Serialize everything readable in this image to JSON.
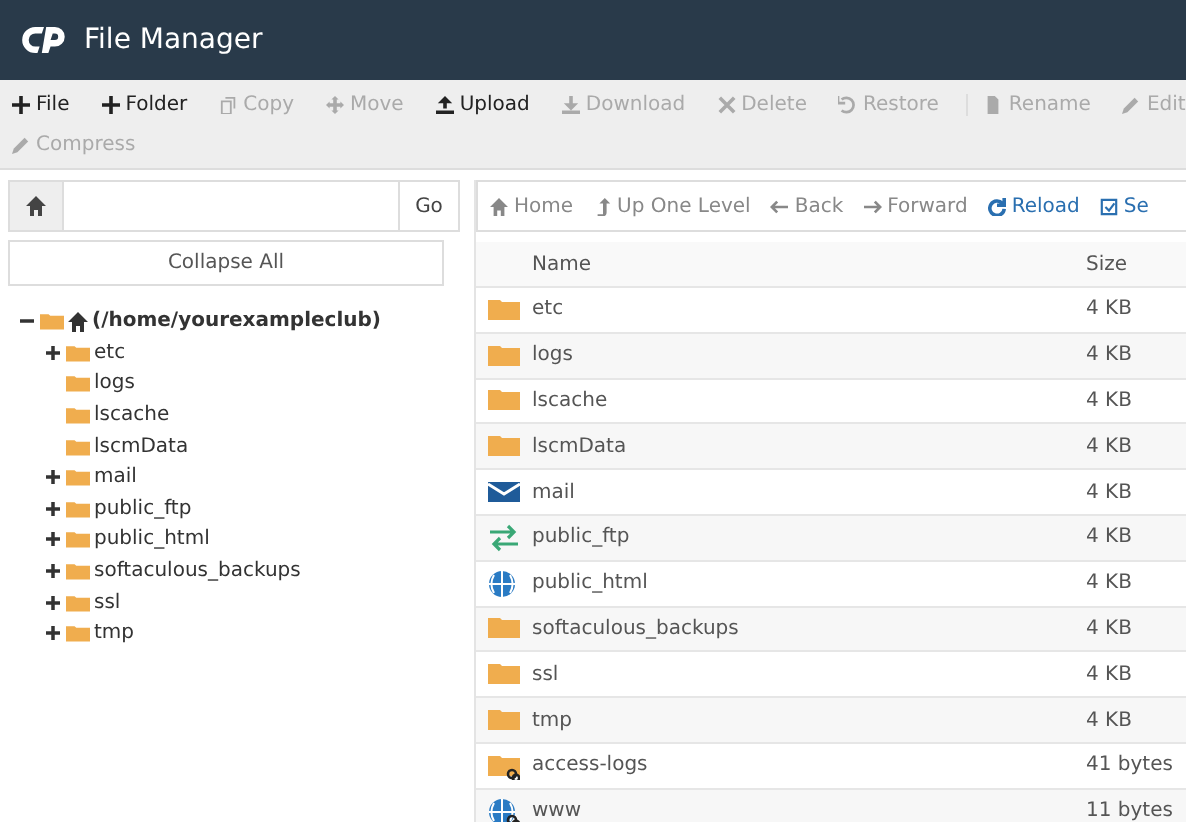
{
  "window": {
    "title": "File Manager"
  },
  "toolbar": [
    [
      {
        "label": "File",
        "kind": "plus",
        "disabled": false
      },
      {
        "label": "Folder",
        "kind": "plus",
        "disabled": false
      },
      {
        "label": "Copy",
        "kind": "copy",
        "disabled": true
      },
      {
        "label": "Move",
        "kind": "move",
        "disabled": true
      },
      {
        "label": "Upload",
        "kind": "upload",
        "disabled": false
      },
      {
        "label": "Download",
        "kind": "download",
        "disabled": true
      },
      {
        "label": "Delete",
        "kind": "delete",
        "disabled": true
      },
      {
        "label": "Restore",
        "kind": "restore",
        "disabled": true
      },
      {
        "label": "Rename",
        "kind": "rename",
        "disabled": true
      },
      {
        "label": "Edit",
        "kind": "edit",
        "disabled": true
      }
    ],
    [
      {
        "label": "Compress",
        "kind": "compress",
        "disabled": true
      }
    ]
  ],
  "path_bar": {
    "button": "Go"
  },
  "collapse_button": "Collapse All",
  "tree": [
    {
      "label": "(/home/yourexampleclub)",
      "kind": "root",
      "expanded": true,
      "children": [
        {
          "label": "etc",
          "kind": "branch",
          "expanded": false
        },
        {
          "label": "logs",
          "kind": "leaf",
          "expanded": false
        },
        {
          "label": "lscache",
          "kind": "leaf",
          "expanded": false
        },
        {
          "label": "lscmData",
          "kind": "leaf",
          "expanded": false
        },
        {
          "label": "mail",
          "kind": "branch",
          "expanded": false
        },
        {
          "label": "public_ftp",
          "kind": "branch",
          "expanded": false
        },
        {
          "label": "public_html",
          "kind": "branch",
          "expanded": false
        },
        {
          "label": "softaculous_backups",
          "kind": "branch",
          "expanded": false
        },
        {
          "label": "ssl",
          "kind": "branch",
          "expanded": false
        },
        {
          "label": "tmp",
          "kind": "branch",
          "expanded": false
        }
      ]
    }
  ],
  "nav": [
    {
      "label": "Home",
      "kind": "home"
    },
    {
      "label": "Up One Level",
      "kind": "up"
    },
    {
      "label": "Back",
      "kind": "back"
    },
    {
      "label": "Forward",
      "kind": "forward"
    },
    {
      "label": "Reload",
      "kind": "reload"
    },
    {
      "label": "Se",
      "kind": "select"
    }
  ],
  "table": {
    "columns": [
      "Name",
      "Size"
    ],
    "rows": [
      {
        "name": "etc",
        "size": "4 KB",
        "kind": "folder"
      },
      {
        "name": "logs",
        "size": "4 KB",
        "kind": "folder"
      },
      {
        "name": "lscache",
        "size": "4 KB",
        "kind": "folder"
      },
      {
        "name": "lscmData",
        "size": "4 KB",
        "kind": "folder"
      },
      {
        "name": "mail",
        "size": "4 KB",
        "kind": "mail"
      },
      {
        "name": "public_ftp",
        "size": "4 KB",
        "kind": "ftp"
      },
      {
        "name": "public_html",
        "size": "4 KB",
        "kind": "web"
      },
      {
        "name": "softaculous_backups",
        "size": "4 KB",
        "kind": "folder"
      },
      {
        "name": "ssl",
        "size": "4 KB",
        "kind": "folder"
      },
      {
        "name": "tmp",
        "size": "4 KB",
        "kind": "folder"
      },
      {
        "name": "access-logs",
        "size": "41 bytes",
        "kind": "folder-link"
      },
      {
        "name": "www",
        "size": "11 bytes",
        "kind": "web-link"
      }
    ]
  }
}
